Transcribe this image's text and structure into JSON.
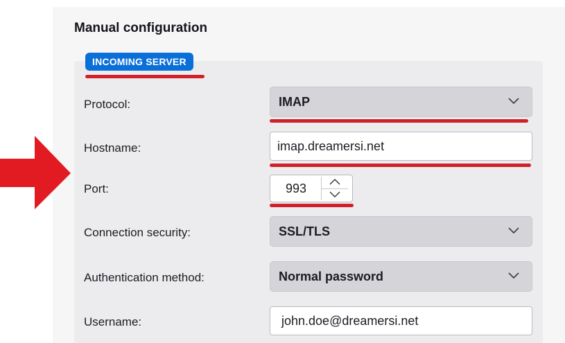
{
  "section_title": "Manual configuration",
  "legend": "INCOMING SERVER",
  "fields": {
    "protocol": {
      "label": "Protocol:",
      "value": "IMAP"
    },
    "hostname": {
      "label": "Hostname:",
      "value": "imap.dreamersi.net"
    },
    "port": {
      "label": "Port:",
      "value": "993"
    },
    "connection_security": {
      "label": "Connection security:",
      "value": "SSL/TLS"
    },
    "authentication": {
      "label": "Authentication method:",
      "value": "Normal password"
    },
    "username": {
      "label": "Username:",
      "value": "john.doe@dreamersi.net"
    }
  },
  "colors": {
    "accent": "#0a6fd8",
    "annotation_red": "#d0202a",
    "select_bg": "#d4d4d9"
  },
  "icons": {
    "dropdown": "chevron-down-icon",
    "spin_up": "chevron-up-icon",
    "spin_down": "chevron-down-icon",
    "pointer": "red-arrow-annotation"
  }
}
